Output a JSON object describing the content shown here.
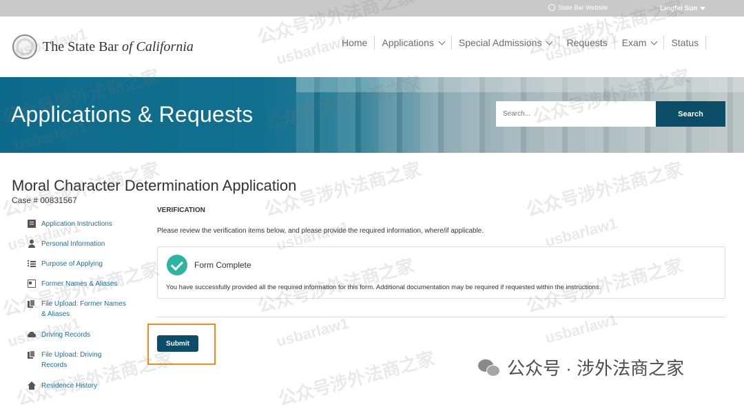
{
  "topbar": {
    "site_link": "State Bar Website",
    "user_name": "Lingfei Sun"
  },
  "header": {
    "logo_text_a": "The State Bar ",
    "logo_text_b": "of California",
    "nav": [
      {
        "label": "Home",
        "has_dropdown": false
      },
      {
        "label": "Applications",
        "has_dropdown": true
      },
      {
        "label": "Special Admissions",
        "has_dropdown": true
      },
      {
        "label": "Requests",
        "has_dropdown": false
      },
      {
        "label": "Exam",
        "has_dropdown": true
      },
      {
        "label": "Status",
        "has_dropdown": false
      }
    ]
  },
  "banner": {
    "title": "Applications & Requests",
    "search_placeholder": "Search...",
    "search_button": "Search"
  },
  "page": {
    "title": "Moral Character Determination Application",
    "case_number": "Case # 00831567"
  },
  "sidebar": {
    "items": [
      {
        "label": "Application Instructions",
        "icon": "document-icon"
      },
      {
        "label": "Personal Information",
        "icon": "person-icon"
      },
      {
        "label": "Purpose of Applying",
        "icon": "list-icon"
      },
      {
        "label": "Former Names & Aliases",
        "icon": "id-card-icon"
      },
      {
        "label": "File Upload: Former Names & Aliases",
        "icon": "files-icon"
      },
      {
        "label": "Driving Records",
        "icon": "car-icon"
      },
      {
        "label": "File Upload: Driving Records",
        "icon": "files-icon"
      },
      {
        "label": "Residence History",
        "icon": "home-icon"
      }
    ]
  },
  "main": {
    "section_title": "VERIFICATION",
    "instructions": "Please review the verification items below, and please provide the required information, where/if applicable.",
    "status": {
      "title": "Form Complete",
      "description": "You have successfully provided all the required information for this form. Additional documentation may be required if requested within the instructions."
    },
    "submit_label": "Submit"
  },
  "watermark": {
    "cn_text": "公众号涉外法商之家",
    "en_text": "usbarlaw1",
    "brand": "公众号 · 涉外法商之家"
  },
  "colors": {
    "primary_dark": "#0b4d66",
    "banner_teal": "#0e6a8a",
    "link_blue": "#1a6fa0",
    "success_green": "#2bb5a0",
    "highlight_orange": "#f08a1c"
  }
}
